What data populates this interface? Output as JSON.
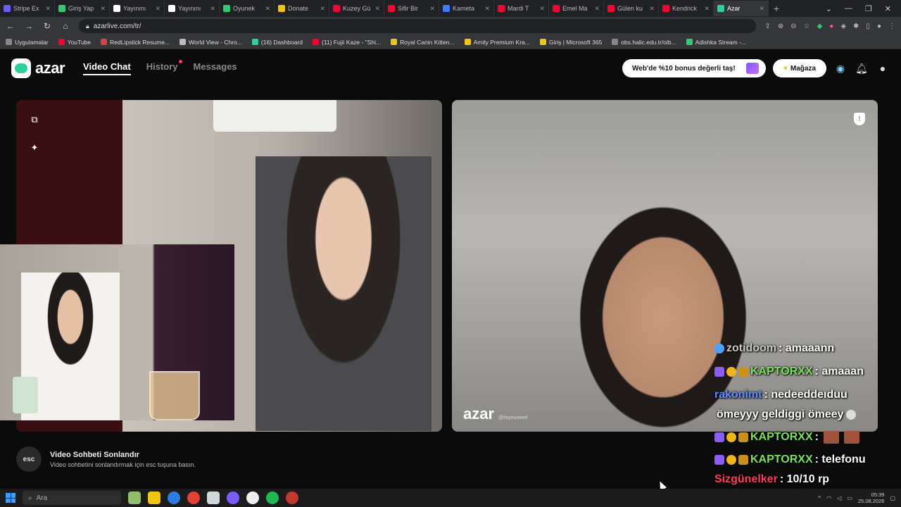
{
  "browser": {
    "tabs": [
      {
        "label": "Stripe Ex",
        "color": "#6a5cff"
      },
      {
        "label": "Giriş Yap",
        "color": "#2ecc71"
      },
      {
        "label": "Yayınını",
        "color": "#ffffff"
      },
      {
        "label": "Yayınını",
        "color": "#ffffff"
      },
      {
        "label": "Oyunek",
        "color": "#2ecc71"
      },
      {
        "label": "Donate",
        "color": "#f1c40f"
      },
      {
        "label": "Kuzey Gü",
        "color": "#ff0033"
      },
      {
        "label": "Sifir Bir",
        "color": "#ff0033"
      },
      {
        "label": "Kameta",
        "color": "#3a7bff"
      },
      {
        "label": "Mardi T",
        "color": "#ff0033"
      },
      {
        "label": "Emel Ma",
        "color": "#ff0033"
      },
      {
        "label": "Gülen ku",
        "color": "#ff0033"
      },
      {
        "label": "Kendrick",
        "color": "#ff0033"
      },
      {
        "label": "Azar",
        "color": "#2ed19a",
        "active": true
      }
    ],
    "new_tab": "+",
    "url": "azarlive.com/tr/",
    "bookmarks": [
      {
        "label": "Uygulamalar",
        "color": "#888888"
      },
      {
        "label": "YouTube",
        "color": "#ff0033"
      },
      {
        "label": "RedLipstick Resume...",
        "color": "#d94343"
      },
      {
        "label": "World View - Chro...",
        "color": "#bbbbbb"
      },
      {
        "label": "(16) Dashboard",
        "color": "#2ed19a"
      },
      {
        "label": "(11) Fujii Kaze - \"Shi...",
        "color": "#ff0033"
      },
      {
        "label": "Royal Canin Kitten...",
        "color": "#f1c40f"
      },
      {
        "label": "Amity Premium Kra...",
        "color": "#f1c40f"
      },
      {
        "label": "Giriş | Microsoft 365",
        "color": "#f1c40f"
      },
      {
        "label": "obs.halic.edu.tr/oib...",
        "color": "#888888"
      },
      {
        "label": "Adishka Stream -...",
        "color": "#2ecc71"
      }
    ]
  },
  "app": {
    "logo": "azar",
    "nav": {
      "video_chat": "Video Chat",
      "history": "History",
      "messages": "Messages"
    },
    "promo": "Web'de %10 bonus değerli taş!",
    "store": "Mağaza",
    "watermark": "azar",
    "watermark_sub": "@itsyouneed"
  },
  "esc_bar": {
    "key": "esc",
    "title": "Video Sohbeti Sonlandır",
    "subtitle": "Video sohbetini sonlandırmak için esc tuşuna basın."
  },
  "chat": [
    {
      "user": "zotidoom",
      "text": ": amaaann"
    },
    {
      "user": "KAPTORXX",
      "text": ": amaaan"
    },
    {
      "user": "rakonimt",
      "text": ": nedeeddeıduu"
    },
    {
      "user": "",
      "text": "ömeyyy geldiggi ömeey"
    },
    {
      "user": "KAPTORXX",
      "text": ":"
    },
    {
      "user": "KAPTORXX",
      "text": ": telefonu"
    },
    {
      "user": "Sizgünelker",
      "text": ": 10/10 rp"
    }
  ],
  "taskbar": {
    "search": "Ara",
    "time": "05:39",
    "date": "25.08.2026"
  }
}
